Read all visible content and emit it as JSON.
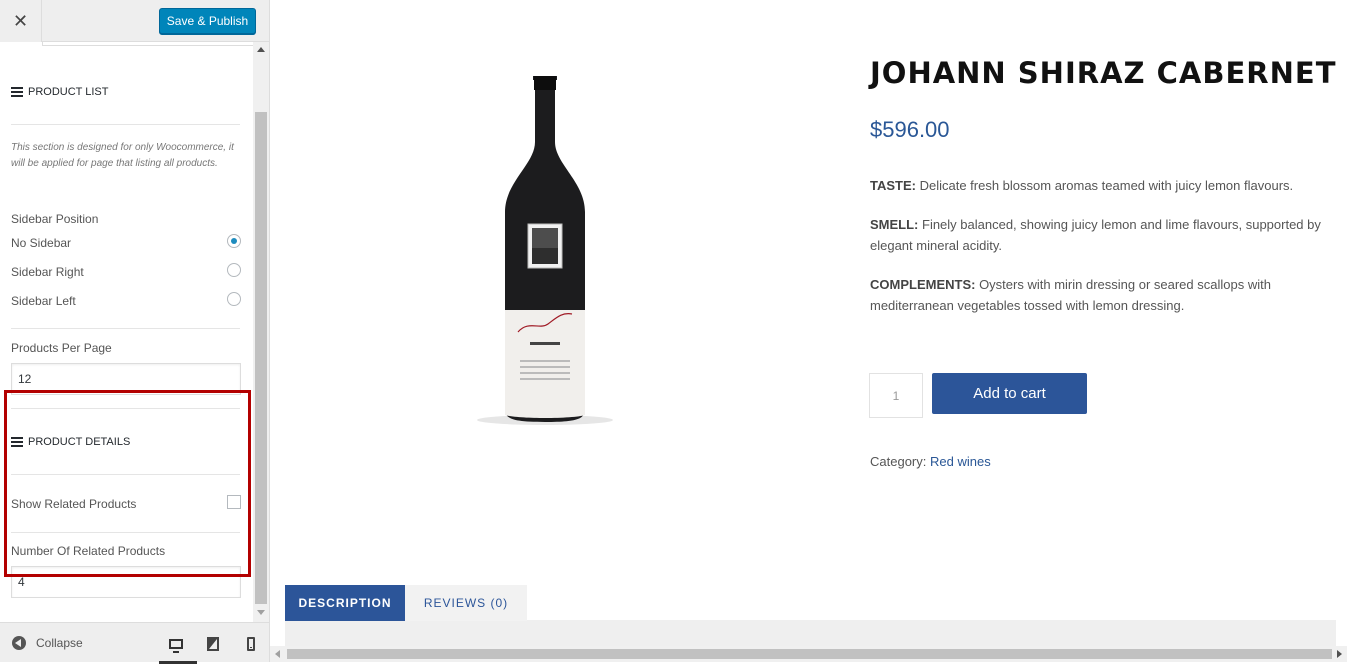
{
  "customizer": {
    "close_icon": "close-icon",
    "close_glyph": "✕",
    "publish_label": "Save & Publish",
    "product_list": {
      "title": "PRODUCT LIST",
      "description": "This section is designed for only Woocommerce, it will be applied for page that listing all products.",
      "sidebar_position_label": "Sidebar Position",
      "options": [
        "No Sidebar",
        "Sidebar Right",
        "Sidebar Left"
      ],
      "selected_option": "No Sidebar",
      "per_page_label": "Products Per Page",
      "per_page_value": "12"
    },
    "product_details": {
      "title": "PRODUCT DETAILS",
      "show_related_label": "Show Related Products",
      "show_related_checked": false,
      "related_count_label": "Number Of Related Products",
      "related_count_value": "4"
    },
    "collapse_label": "Collapse",
    "devices": [
      "desktop",
      "tablet",
      "mobile"
    ],
    "active_device": "desktop"
  },
  "product": {
    "title": "JOHANN SHIRAZ CABERNET",
    "price": "$596.00",
    "taste_label": "TASTE:",
    "taste_text": " Delicate fresh blossom aromas teamed with juicy lemon flavours.",
    "smell_label": "SMELL:",
    "smell_text": " Finely balanced, showing juicy lemon and lime flavours, supported by elegant mineral acidity.",
    "complements_label": "COMPLEMENTS:",
    "complements_text": " Oysters with mirin dressing or seared scallops with mediterranean vegetables tossed with lemon dressing.",
    "quantity": "1",
    "add_to_cart_label": "Add to cart",
    "category_label": "Category:",
    "category_link": "Red wines",
    "tabs": [
      "DESCRIPTION",
      "REVIEWS (0)"
    ],
    "active_tab": "DESCRIPTION"
  },
  "colors": {
    "publish_blue": "#0085ba",
    "brand_blue": "#2c5599",
    "highlight_red": "#b30000"
  }
}
